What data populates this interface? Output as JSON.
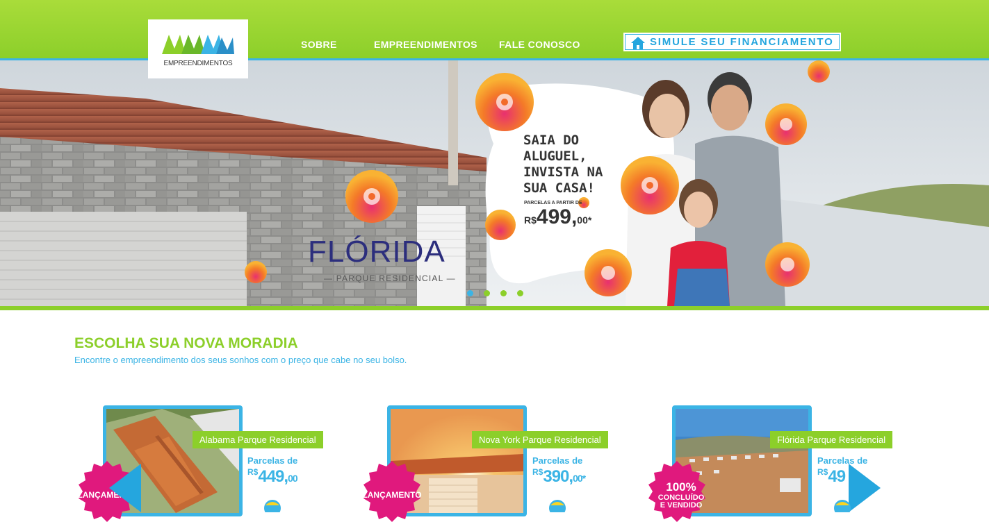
{
  "header": {
    "logo_text": "EMPREENDIMENTOS",
    "nav": [
      "SOBRE",
      "EMPREENDIMENTOS",
      "FALE CONOSCO"
    ],
    "cta": "SIMULE SEU FINANCIAMENTO"
  },
  "hero": {
    "brand": "FLÓRIDA",
    "brand_sub": "— PARQUE RESIDENCIAL —",
    "bubble_lines": [
      "SAIA DO",
      "ALUGUEL,",
      "INVISTA NA",
      "SUA CASA!"
    ],
    "parcelas_small": "PARCELAS A PARTIR DE",
    "price_currency": "R$",
    "price_main": "499,",
    "price_cents": "00*",
    "slides": 4,
    "active_slide": 1
  },
  "section": {
    "title": "ESCOLHA SUA NOVA MORADIA",
    "subtitle": "Encontre o empreendimento dos seus sonhos com o preço que cabe no seu bolso."
  },
  "cards": [
    {
      "label": "Alabama Parque Residencial",
      "parcelas": "Parcelas de",
      "currency": "R$",
      "price": "449,",
      "cents": "00",
      "badge": "LANÇAMENTO"
    },
    {
      "label": "Nova York Parque Residencial",
      "parcelas": "Parcelas de",
      "currency": "R$",
      "price": "390,",
      "cents": "00*",
      "badge": "LANÇAMENTO"
    },
    {
      "label": "Flórida Parque Residencial",
      "parcelas": "Parcelas de",
      "currency": "R$",
      "price": "49",
      "cents": "",
      "badge_lines": [
        "100%",
        "CONCLUÍDO",
        "E VENDIDO"
      ]
    }
  ],
  "colors": {
    "green": "#8ccf2a",
    "blue": "#3bb4e5",
    "magenta": "#e0197d",
    "navy": "#2c2e7d"
  }
}
